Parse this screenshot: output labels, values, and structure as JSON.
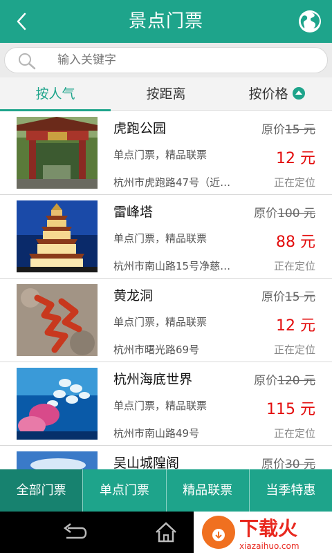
{
  "header": {
    "title": "景点门票"
  },
  "search": {
    "placeholder": "输入关键字"
  },
  "sort_tabs": [
    {
      "label": "按人气",
      "active": true
    },
    {
      "label": "按距离",
      "active": false
    },
    {
      "label": "按价格",
      "active": false
    }
  ],
  "items": [
    {
      "name": "虎跑公园",
      "orig_prefix": "原价",
      "orig_value": "15 元",
      "type": "单点门票，精品联票",
      "price": "12 元",
      "address": "杭州市虎跑路47号（近…",
      "status": "正在定位"
    },
    {
      "name": "雷峰塔",
      "orig_prefix": "原价",
      "orig_value": "100 元",
      "type": "单点门票，精品联票",
      "price": "88 元",
      "address": "杭州市南山路15号净慈…",
      "status": "正在定位"
    },
    {
      "name": "黄龙洞",
      "orig_prefix": "原价",
      "orig_value": "15 元",
      "type": "单点门票，精品联票",
      "price": "12 元",
      "address": "杭州市曙光路69号",
      "status": "正在定位"
    },
    {
      "name": "杭州海底世界",
      "orig_prefix": "原价",
      "orig_value": "120 元",
      "type": "单点门票，精品联票",
      "price": "115 元",
      "address": "杭州市南山路49号",
      "status": "正在定位"
    },
    {
      "name": "吴山城隍阁",
      "orig_prefix": "原价",
      "orig_value": "30 元",
      "type": "",
      "price": "",
      "address": "",
      "status": ""
    }
  ],
  "bottom_tabs": [
    {
      "label": "全部门票",
      "active": true
    },
    {
      "label": "单点门票",
      "active": false
    },
    {
      "label": "精品联票",
      "active": false
    },
    {
      "label": "当季特惠",
      "active": false
    }
  ],
  "watermark": {
    "brand": "下载火",
    "domain": "xiazaihuo.com"
  },
  "colors": {
    "accent": "#1ea48b",
    "price": "#e30d0d"
  }
}
